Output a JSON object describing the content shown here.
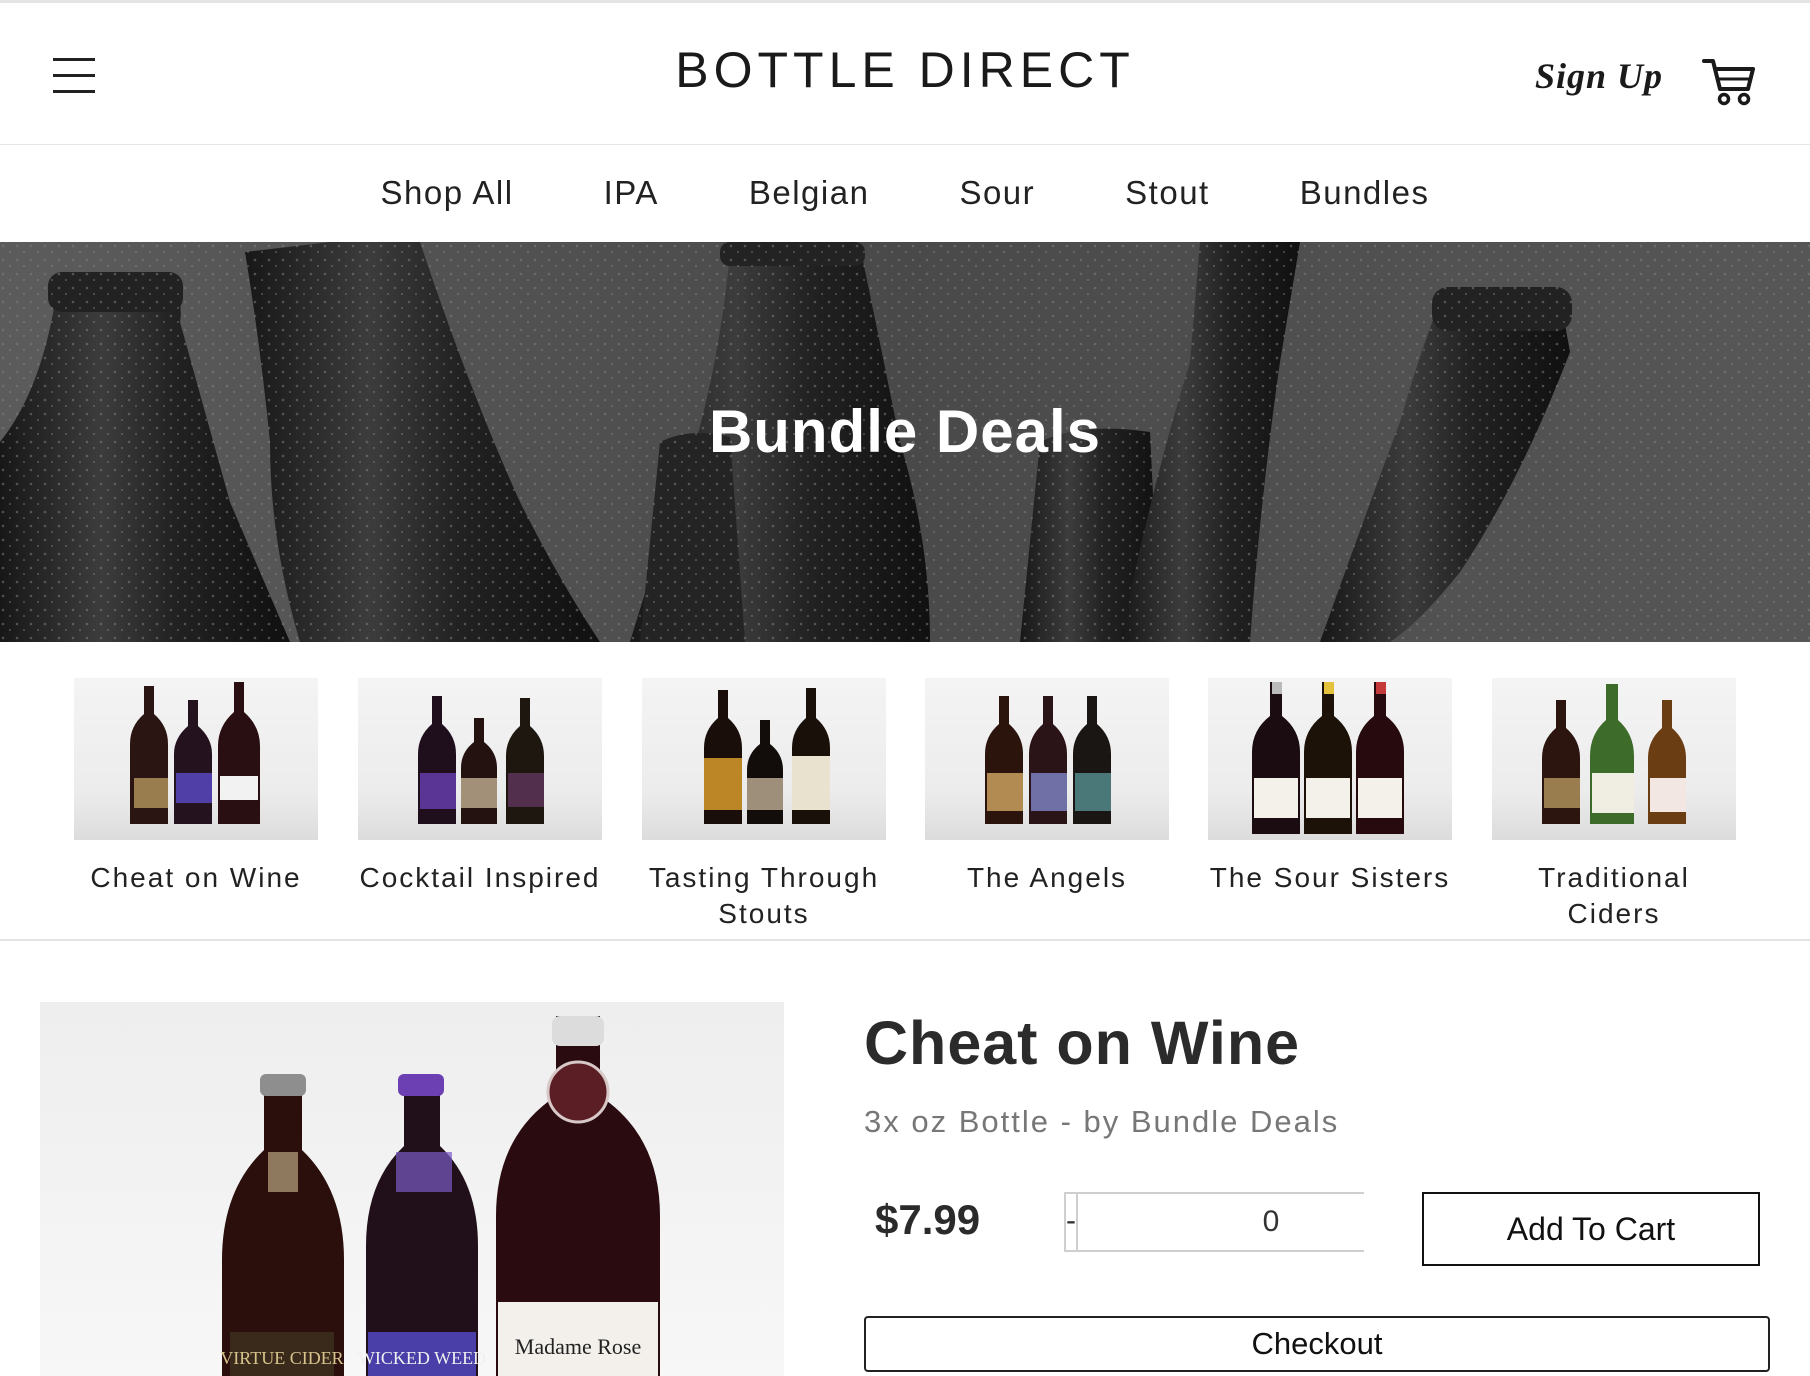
{
  "header": {
    "brand": "BOTTLE DIRECT",
    "sign_up_label": "Sign Up",
    "menu_icon": "hamburger-menu-icon",
    "cart_icon": "shopping-cart-icon"
  },
  "nav": {
    "items": [
      "Shop All",
      "IPA",
      "Belgian",
      "Sour",
      "Stout",
      "Bundles"
    ]
  },
  "hero": {
    "title": "Bundle Deals"
  },
  "bundles": {
    "items": [
      {
        "label": "Cheat on Wine"
      },
      {
        "label": "Cocktail Inspired"
      },
      {
        "label": "Tasting Through Stouts"
      },
      {
        "label": "The Angels"
      },
      {
        "label": "The Sour Sisters"
      },
      {
        "label": "Traditional Ciders"
      }
    ]
  },
  "product": {
    "title": "Cheat on Wine",
    "subtitle": "3x oz Bottle - by Bundle Deals",
    "price": "$7.99",
    "quantity": "0",
    "minus_label": "-",
    "plus_label": "+",
    "add_to_cart_label": "Add To Cart",
    "checkout_label": "Checkout",
    "bottle_labels": [
      "VIRTUE CIDER",
      "WICKED WEED",
      "Madame Rose"
    ]
  },
  "colors": {
    "hero_overlay": "#5f5f5f",
    "text_dark": "#222222",
    "text_muted": "#777777",
    "border": "#cfcfcf"
  }
}
